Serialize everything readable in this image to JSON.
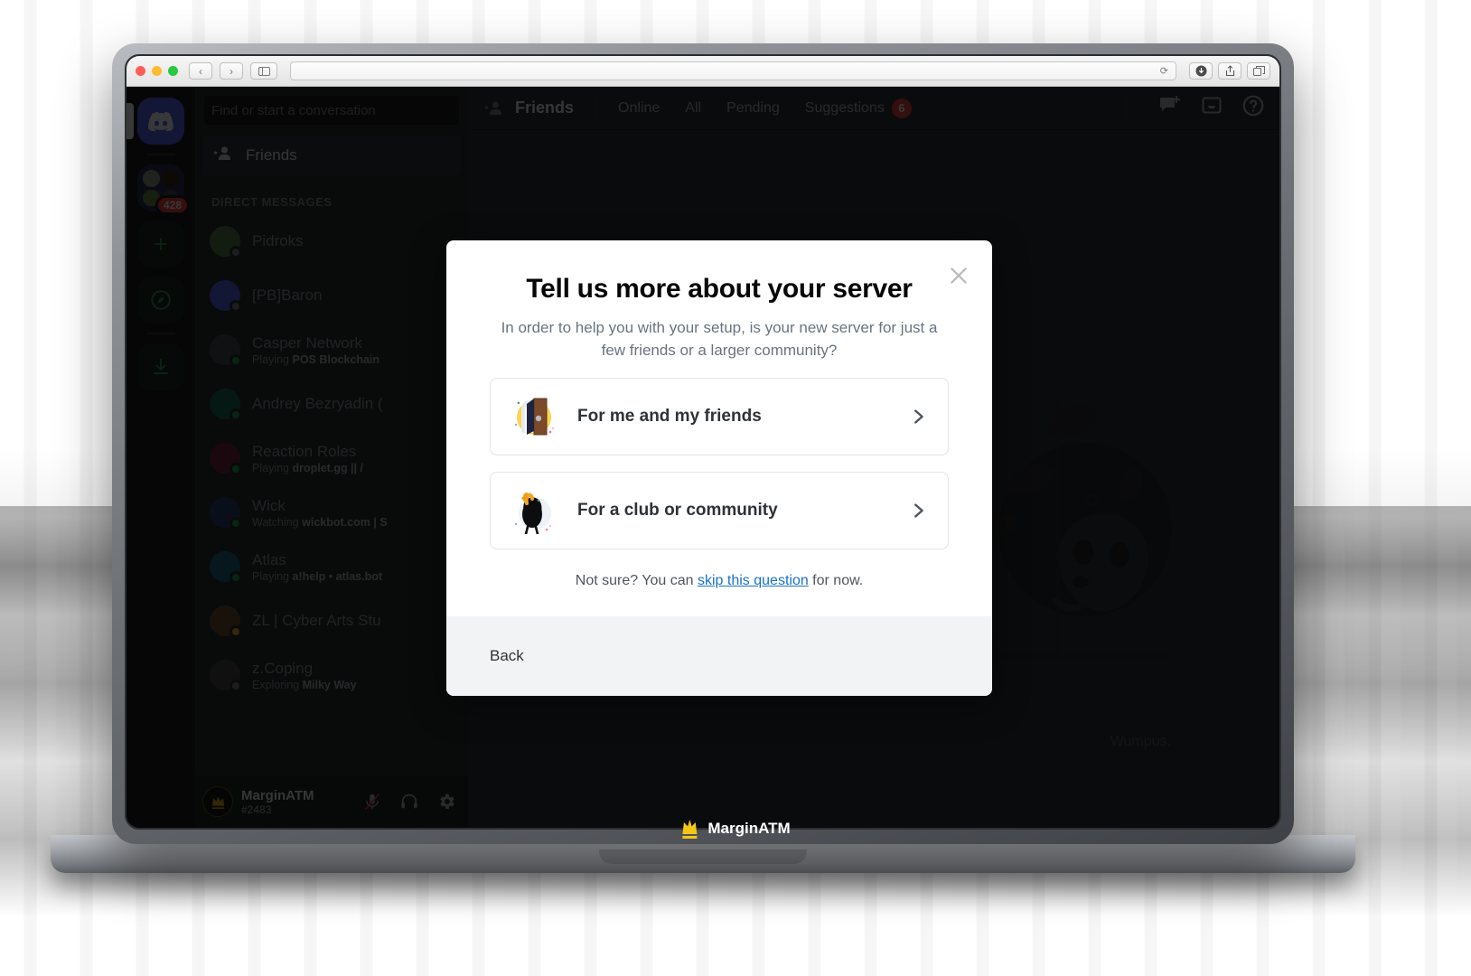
{
  "browser": {
    "back_label": "‹",
    "forward_label": "›",
    "sidebar_icon": "sidebar-icon",
    "url_value": "",
    "reload_icon": "reload-icon",
    "downloads_icon": "downloads-icon",
    "share_icon": "share-icon",
    "tabs_icon": "tabs-icon"
  },
  "server_rail": {
    "items": [
      {
        "name": "home",
        "icon": "discord-logo-icon",
        "badge": ""
      },
      {
        "name": "server-folder",
        "icon": "folder-icon",
        "badge": "428"
      },
      {
        "name": "add-server",
        "icon": "plus-icon",
        "badge": ""
      },
      {
        "name": "explore",
        "icon": "compass-icon",
        "badge": ""
      },
      {
        "name": "download-apps",
        "icon": "download-icon",
        "badge": ""
      }
    ]
  },
  "sidebar": {
    "search_placeholder": "Find or start a conversation",
    "friends_label": "Friends",
    "section_title": "DIRECT MESSAGES",
    "dms": [
      {
        "name": "Pidroks",
        "status": "offline",
        "activity_prefix": "",
        "activity": ""
      },
      {
        "name": "[PB]Baron",
        "status": "offline",
        "activity_prefix": "",
        "activity": ""
      },
      {
        "name": "Casper Network",
        "status": "online",
        "activity_prefix": "Playing ",
        "activity": "POS Blockchain"
      },
      {
        "name": "Andrey Bezryadin (",
        "status": "online",
        "activity_prefix": "",
        "activity": ""
      },
      {
        "name": "Reaction Roles",
        "status": "online",
        "activity_prefix": "Playing ",
        "activity": "droplet.gg || /"
      },
      {
        "name": "Wick",
        "status": "online",
        "activity_prefix": "Watching ",
        "activity": "wickbot.com | S"
      },
      {
        "name": "Atlas",
        "status": "online",
        "activity_prefix": "Playing ",
        "activity": "a!help • atlas.bot"
      },
      {
        "name": "ZL | Cyber Arts Stu",
        "status": "idle",
        "activity_prefix": "",
        "activity": ""
      },
      {
        "name": "z.Coping",
        "status": "offline",
        "activity_prefix": "Exploring ",
        "activity": "Milky Way"
      }
    ]
  },
  "user_panel": {
    "name": "MarginATM",
    "tag": "#2483",
    "mute_icon": "microphone-muted-icon",
    "deafen_icon": "headphones-icon",
    "settings_icon": "gear-icon"
  },
  "main_header": {
    "friends_icon": "friends-icon",
    "title": "Friends",
    "tabs": [
      {
        "label": "Online",
        "badge": ""
      },
      {
        "label": "All",
        "badge": ""
      },
      {
        "label": "Pending",
        "badge": ""
      },
      {
        "label": "Suggestions",
        "badge": "6"
      }
    ],
    "new_dm_icon": "new-dm-icon",
    "inbox_icon": "inbox-icon",
    "help_icon": "help-icon"
  },
  "main_body": {
    "empty_caption": "Wumpus."
  },
  "modal": {
    "title": "Tell us more about your server",
    "subtitle": "In order to help you with your setup, is your new server for just a few friends or a larger community?",
    "close_icon": "close-icon",
    "options": [
      {
        "label": "For me and my friends",
        "art": "door-illustration",
        "chevron": "chevron-right-icon"
      },
      {
        "label": "For a club or community",
        "art": "wumpus-wave-illustration",
        "chevron": "chevron-right-icon"
      }
    ],
    "skip_prefix": "Not sure? You can ",
    "skip_link": "skip this question",
    "skip_suffix": " for now.",
    "back_label": "Back"
  },
  "watermark": {
    "text": "MarginATM",
    "logo": "crown-icon"
  },
  "colors": {
    "brand_blurple": "#5865f2",
    "danger_red": "#f23f43",
    "online_green": "#23a55a",
    "idle_yellow": "#f0b232",
    "link_blue": "#1a73c7",
    "watermark_gold": "#f5c518"
  }
}
